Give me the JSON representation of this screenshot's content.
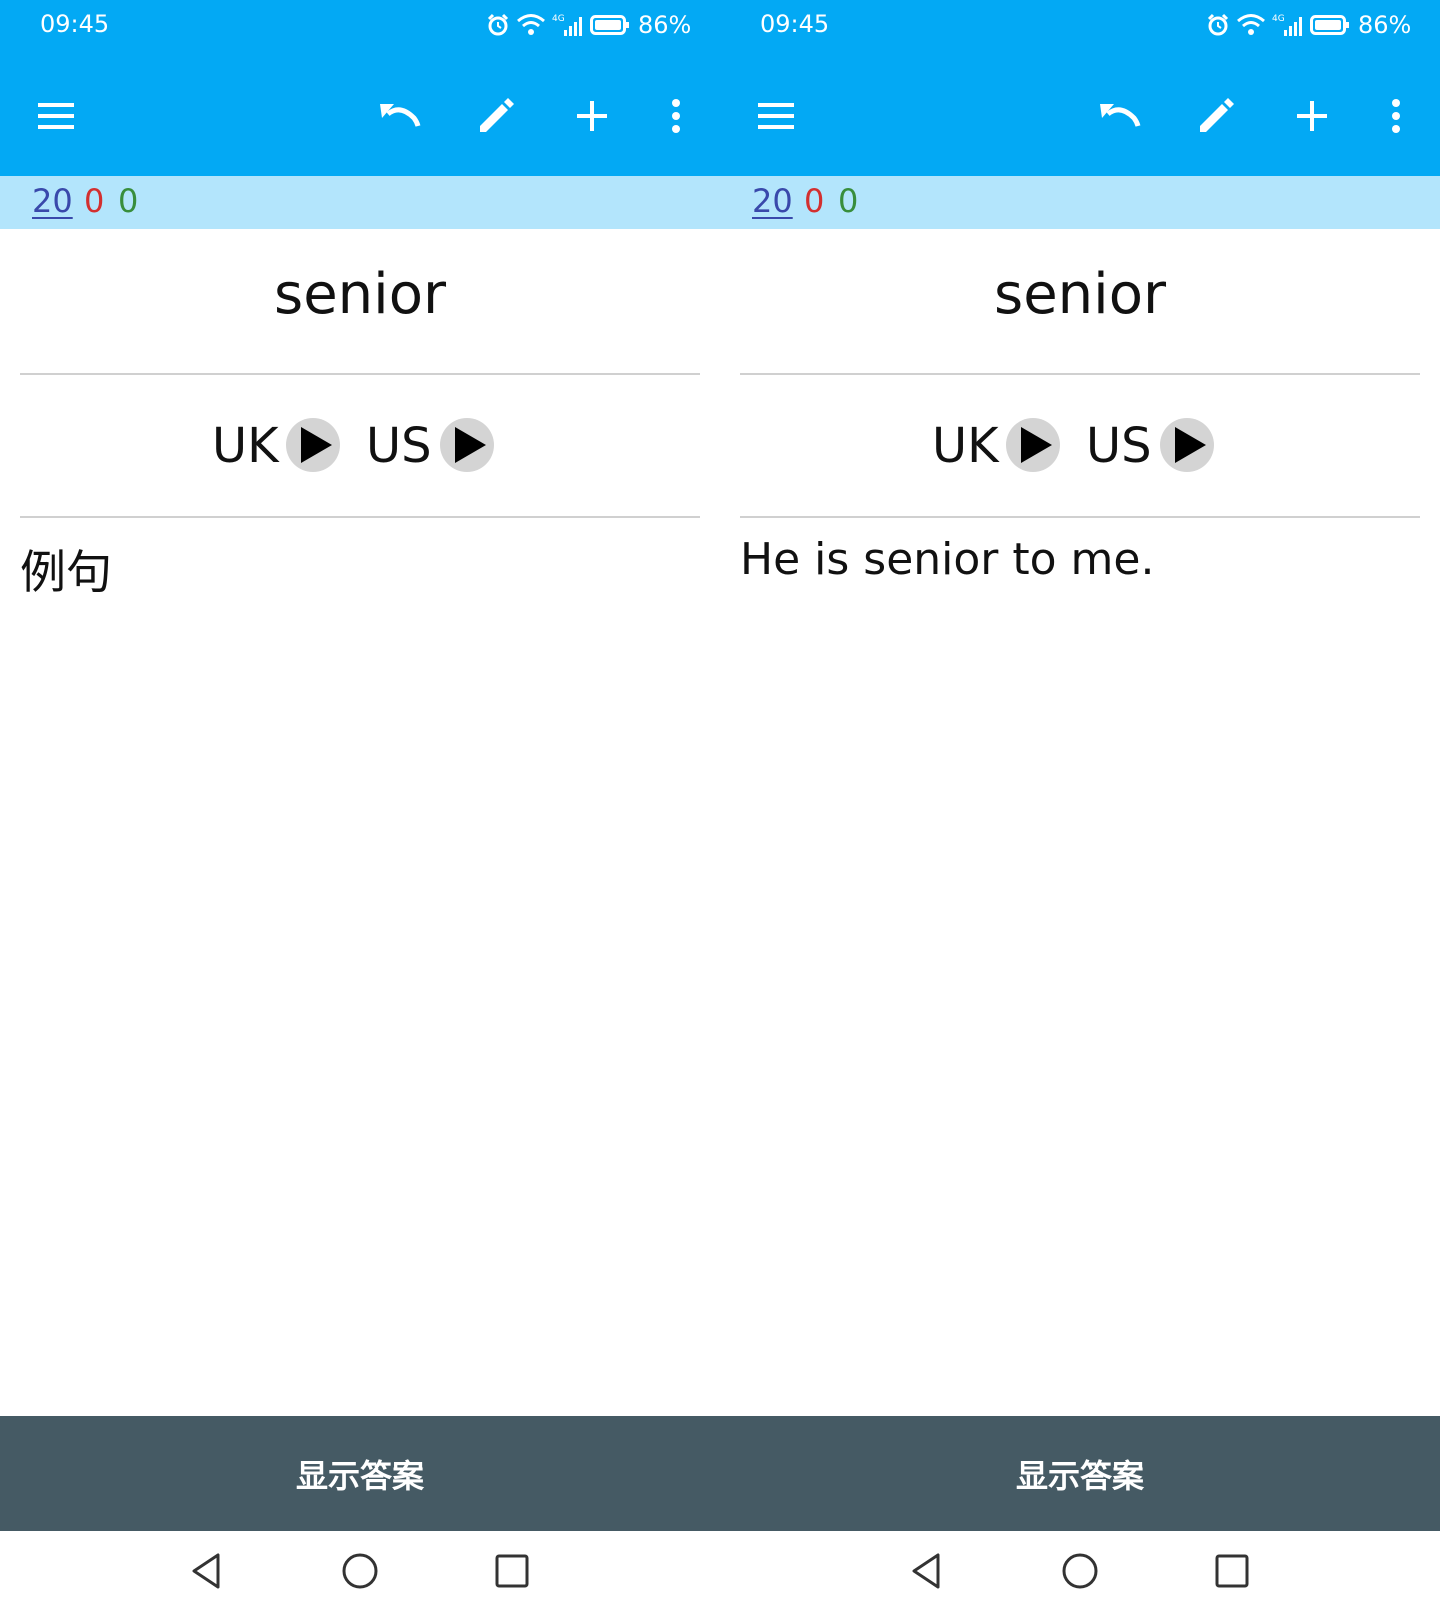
{
  "panels": [
    {
      "status": {
        "time": "09:45",
        "battery": "86%"
      },
      "counts": {
        "new": "20",
        "red": "0",
        "green": "0"
      },
      "card": {
        "word": "senior",
        "uk_label": "UK",
        "us_label": "US",
        "example": "例句"
      },
      "answer_button": "显示答案"
    },
    {
      "status": {
        "time": "09:45",
        "battery": "86%"
      },
      "counts": {
        "new": "20",
        "red": "0",
        "green": "0"
      },
      "card": {
        "word": "senior",
        "uk_label": "UK",
        "us_label": "US",
        "example": "He is senior to me."
      },
      "answer_button": "显示答案"
    }
  ],
  "icons": {
    "toolbar": [
      "menu-icon",
      "undo-icon",
      "edit-pencil-icon",
      "add-icon",
      "more-vert-icon"
    ],
    "status": [
      "alarm-icon",
      "wifi-icon",
      "signal-4g-icon",
      "battery-icon"
    ],
    "navigation": [
      "back-icon",
      "home-icon",
      "recents-icon"
    ]
  },
  "colors": {
    "appbar": "#03a9f4",
    "countbar": "#b3e5fc",
    "answer_button": "#455a64",
    "count_new": "#3949ab",
    "count_red": "#d32f2f",
    "count_green": "#388e3c"
  }
}
